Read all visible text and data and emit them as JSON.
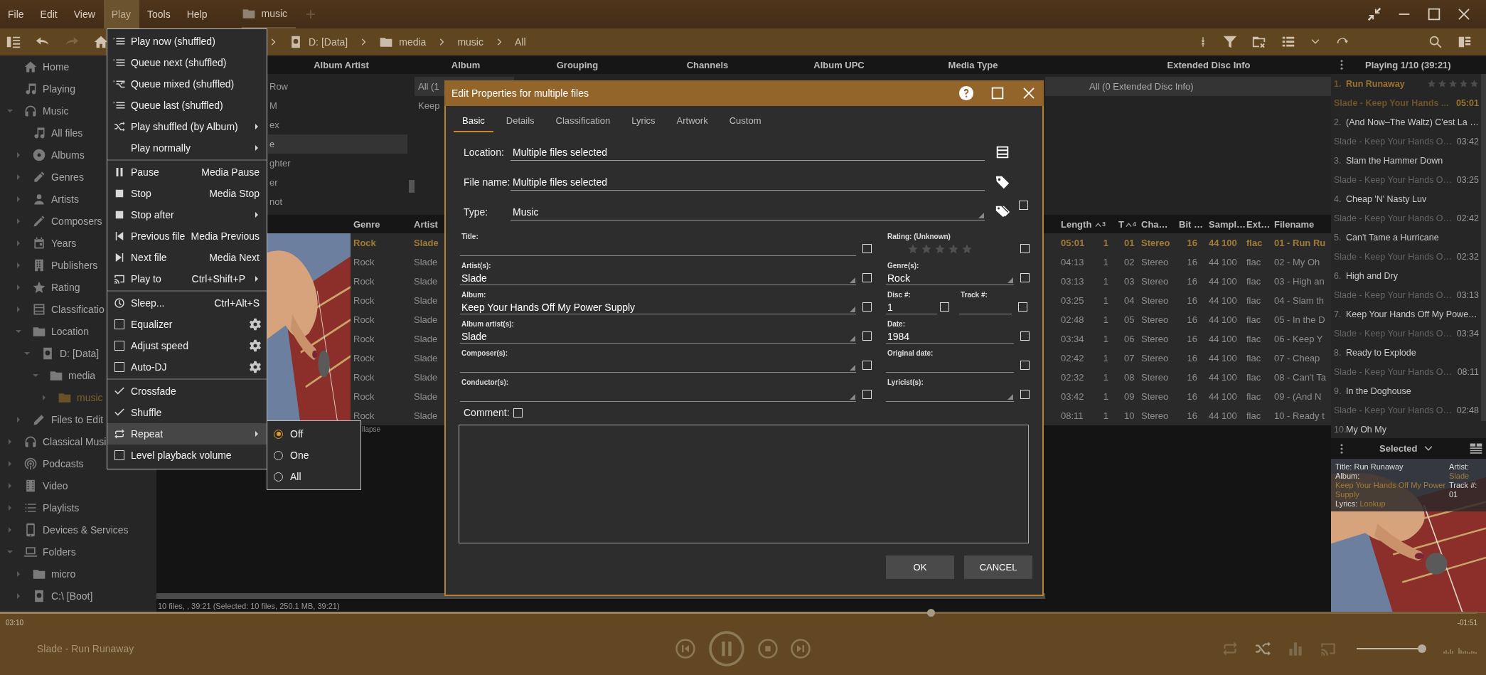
{
  "menu_bar": {
    "menus": [
      {
        "label": "File",
        "selected": false
      },
      {
        "label": "Edit",
        "selected": false
      },
      {
        "label": "View",
        "selected": false
      },
      {
        "label": "Play",
        "selected": true
      },
      {
        "label": "Tools",
        "selected": false
      },
      {
        "label": "Help",
        "selected": false
      }
    ],
    "tab": {
      "label": "music"
    }
  },
  "toolbar": {
    "breadcrumb": [
      {
        "label": "D: [Data]"
      },
      {
        "label": "media"
      },
      {
        "label": "music"
      },
      {
        "label": "All"
      }
    ]
  },
  "sidebar": {
    "items": [
      {
        "label": "Home",
        "selected": false
      },
      {
        "label": "Playing",
        "selected": false
      },
      {
        "label": "Music",
        "selected": false,
        "expanded": true,
        "children": [
          {
            "label": "All files",
            "selected": false
          },
          {
            "label": "Albums",
            "selected": false,
            "expanded": false
          },
          {
            "label": "Genres",
            "selected": false,
            "expanded": false
          },
          {
            "label": "Artists",
            "selected": false,
            "expanded": false
          },
          {
            "label": "Composers",
            "selected": false,
            "expanded": false
          },
          {
            "label": "Years",
            "selected": false,
            "expanded": false
          },
          {
            "label": "Publishers",
            "selected": false,
            "expanded": false
          },
          {
            "label": "Rating",
            "selected": false,
            "expanded": false
          },
          {
            "label": "Classificatio",
            "selected": false,
            "expanded": false
          },
          {
            "label": "Location",
            "selected": false,
            "expanded": true,
            "children": [
              {
                "label": "D: [Data]",
                "selected": false,
                "expanded": true,
                "children": [
                  {
                    "label": "media",
                    "selected": false,
                    "expanded": true,
                    "children": [
                      {
                        "label": "music",
                        "selected": true,
                        "expanded": false
                      }
                    ]
                  }
                ]
              }
            ]
          },
          {
            "label": "Files to Edit",
            "selected": false,
            "expanded": false
          }
        ]
      },
      {
        "label": "Classical Musi",
        "selected": false,
        "expanded": false
      },
      {
        "label": "Podcasts",
        "selected": false,
        "expanded": false
      },
      {
        "label": "Video",
        "selected": false,
        "expanded": false
      },
      {
        "label": "Playlists",
        "selected": false,
        "expanded": false
      },
      {
        "label": "Devices & Services",
        "selected": false,
        "expanded": false
      },
      {
        "label": "Folders",
        "selected": false,
        "expanded": true,
        "children": [
          {
            "label": "micro",
            "selected": false,
            "expanded": false
          },
          {
            "label": "C:\\ [Boot]",
            "selected": false,
            "expanded": false
          }
        ]
      }
    ]
  },
  "categories": [
    {
      "header": "Album Artist",
      "items": [
        {
          "text": "Row",
          "selected": false
        },
        {
          "text": "M",
          "selected": false
        },
        {
          "text": "ex",
          "selected": false
        },
        {
          "text": "e",
          "selected": true
        },
        {
          "text": "ghter",
          "selected": false
        },
        {
          "text": "er",
          "selected": false
        },
        {
          "text": "not",
          "selected": false
        }
      ]
    },
    {
      "header": "Album",
      "items": [
        {
          "text": "All (1",
          "selected": true
        },
        {
          "text": "Keep",
          "selected": false
        }
      ]
    },
    {
      "header": "Grouping"
    },
    {
      "header": "Channels"
    },
    {
      "header": "Album UPC"
    },
    {
      "header": "Media Type"
    },
    {
      "header": "Extended Disc Info",
      "items": [
        {
          "text": "All (0 Extended Disc Info)",
          "selected": true
        }
      ]
    }
  ],
  "file_list": {
    "columns": [
      {
        "label": "Genre"
      },
      {
        "label": "Artist"
      },
      {
        "label": "Length"
      },
      {
        "sort_order": "3"
      },
      {
        "label": "T",
        "sort_order": "4"
      },
      {
        "label": "Cha…"
      },
      {
        "label": "Bit …"
      },
      {
        "label": "Sampl…"
      },
      {
        "label": "Ext…"
      },
      {
        "label": "Filename"
      }
    ],
    "rows": [
      {
        "playing": true,
        "cells": [
          "Rock",
          "Slade",
          "05:01",
          "1",
          "01",
          "Stereo",
          "16",
          "44 100",
          "flac",
          "01 - Run Ru"
        ]
      },
      {
        "playing": false,
        "cells": [
          "Rock",
          "Slade",
          "04:13",
          "1",
          "02",
          "Stereo",
          "16",
          "44 100",
          "flac",
          "02 - My Oh"
        ]
      },
      {
        "playing": false,
        "cells": [
          "Rock",
          "Slade",
          "03:13",
          "1",
          "03",
          "Stereo",
          "16",
          "44 100",
          "flac",
          "03 - High an"
        ]
      },
      {
        "playing": false,
        "cells": [
          "Rock",
          "Slade",
          "03:25",
          "1",
          "04",
          "Stereo",
          "16",
          "44 100",
          "flac",
          "04 - Slam th"
        ]
      },
      {
        "playing": false,
        "cells": [
          "Rock",
          "Slade",
          "02:48",
          "1",
          "05",
          "Stereo",
          "16",
          "44 100",
          "flac",
          "05 - In the D"
        ]
      },
      {
        "playing": false,
        "cells": [
          "Rock",
          "Slade",
          "03:34",
          "1",
          "06",
          "Stereo",
          "16",
          "44 100",
          "flac",
          "06 - Keep Y"
        ]
      },
      {
        "playing": false,
        "cells": [
          "Rock",
          "Slade",
          "02:42",
          "1",
          "07",
          "Stereo",
          "16",
          "44 100",
          "flac",
          "07 - Cheap"
        ]
      },
      {
        "playing": false,
        "cells": [
          "Rock",
          "Slade",
          "02:32",
          "1",
          "08",
          "Stereo",
          "16",
          "44 100",
          "flac",
          "08 - Can't Ta"
        ]
      },
      {
        "playing": false,
        "cells": [
          "Rock",
          "Slade",
          "03:42",
          "1",
          "09",
          "Stereo",
          "16",
          "44 100",
          "flac",
          "09 - (And N"
        ]
      },
      {
        "playing": false,
        "cells": [
          "Rock",
          "Slade",
          "08:11",
          "1",
          "10",
          "Stereo",
          "16",
          "44 100",
          "flac",
          "10 - Ready t"
        ]
      }
    ],
    "group_footer": "llapse",
    "status": "10 files, , 39:21 (Selected: 10 files, 250.1 MB, 39:21)"
  },
  "play_menu": {
    "groups": [
      {
        "items": [
          {
            "kind": "command",
            "label": "Play now (shuffled)",
            "selected": false
          },
          {
            "kind": "command",
            "label": "Queue next (shuffled)",
            "selected": false
          },
          {
            "kind": "command",
            "label": "Queue mixed (shuffled)",
            "selected": false
          },
          {
            "kind": "command",
            "label": "Queue last (shuffled)",
            "selected": false
          },
          {
            "kind": "command",
            "label": "Play shuffled (by Album)",
            "submenu": true,
            "selected": false
          },
          {
            "kind": "command",
            "label": "Play normally",
            "submenu": true,
            "selected": false
          }
        ]
      },
      {
        "items": [
          {
            "kind": "command",
            "label": "Pause",
            "shortcut": "Media Pause",
            "selected": false
          },
          {
            "kind": "command",
            "label": "Stop",
            "shortcut": "Media Stop",
            "selected": false
          },
          {
            "kind": "command",
            "label": "Stop after",
            "submenu": true,
            "selected": false
          },
          {
            "kind": "command",
            "label": "Previous file",
            "shortcut": "Media Previous",
            "selected": false
          },
          {
            "kind": "command",
            "label": "Next file",
            "shortcut": "Media Next",
            "selected": false
          },
          {
            "kind": "command",
            "label": "Play to",
            "shortcut": "Ctrl+Shift+P",
            "submenu": true,
            "selected": false
          }
        ]
      },
      {
        "items": [
          {
            "kind": "command",
            "label": "Sleep...",
            "shortcut": "Ctrl+Alt+S",
            "selected": false
          },
          {
            "kind": "check",
            "label": "Equalizer",
            "checked": false,
            "settings": true,
            "selected": false
          },
          {
            "kind": "check",
            "label": "Adjust speed",
            "checked": false,
            "settings": true,
            "selected": false
          },
          {
            "kind": "check",
            "label": "Auto-DJ",
            "checked": false,
            "settings": true,
            "selected": false
          }
        ]
      },
      {
        "items": [
          {
            "kind": "check",
            "label": "Crossfade",
            "checked": true,
            "selected": false
          },
          {
            "kind": "check",
            "label": "Shuffle",
            "checked": true,
            "selected": false
          },
          {
            "kind": "command",
            "label": "Repeat",
            "submenu": true,
            "selected": true
          },
          {
            "kind": "check",
            "label": "Level playback volume",
            "checked": false,
            "selected": false
          }
        ]
      }
    ]
  },
  "repeat_submenu": {
    "options": [
      {
        "label": "Off",
        "selected": true
      },
      {
        "label": "One",
        "selected": false
      },
      {
        "label": "All",
        "selected": false
      }
    ]
  },
  "dialog": {
    "title": "Edit Properties for multiple files",
    "tabs": [
      {
        "label": "Basic",
        "selected": true
      },
      {
        "label": "Details",
        "selected": false
      },
      {
        "label": "Classification",
        "selected": false
      },
      {
        "label": "Lyrics",
        "selected": false
      },
      {
        "label": "Artwork",
        "selected": false
      },
      {
        "label": "Custom",
        "selected": false
      }
    ],
    "top_fields": [
      {
        "kind": "text",
        "label": "Location:",
        "value": "Multiple files selected"
      },
      {
        "kind": "text",
        "label": "File name:",
        "value": "Multiple files selected"
      },
      {
        "kind": "choice",
        "label": "Type:",
        "value": "Music",
        "checked": false
      }
    ],
    "left_fields": [
      {
        "label": "Title:",
        "dropdown": false,
        "checked": false
      },
      {
        "label": "Artist(s):",
        "value": "Slade",
        "dropdown": true,
        "checked": false
      },
      {
        "label": "Album:",
        "value": "Keep Your Hands Off My Power Supply",
        "dropdown": true,
        "checked": false
      },
      {
        "label": "Album artist(s):",
        "value": "Slade",
        "dropdown": true,
        "checked": false
      },
      {
        "label": "Composer(s):",
        "dropdown": true,
        "checked": false
      },
      {
        "label": "Conductor(s):",
        "dropdown": true,
        "checked": false
      }
    ],
    "right_fields": [
      {
        "kind": "rating",
        "label": "Rating:",
        "value": "(Unknown)",
        "stars": 0,
        "checked": false
      },
      {
        "kind": "field",
        "label": "Genre(s):",
        "value": "Rock",
        "dropdown": true,
        "checked": false
      },
      {
        "kind": "pair",
        "fields": [
          {
            "label": "Disc #:",
            "value": "1",
            "checked": false
          },
          {
            "label": "Track #:",
            "checked": false
          }
        ]
      },
      {
        "kind": "field",
        "label": "Date:",
        "value": "1984",
        "dropdown": false,
        "checked": false
      },
      {
        "kind": "field",
        "label": "Original date:",
        "dropdown": false,
        "checked": false
      },
      {
        "kind": "field",
        "label": "Lyricist(s):",
        "dropdown": true,
        "checked": false
      }
    ],
    "comment": {
      "label": "Comment:",
      "checked": false
    },
    "buttons": [
      "OK",
      "CANCEL"
    ]
  },
  "playing_list": {
    "title": "Playing 1/10 (39:21)",
    "tracks": [
      {
        "number": "1.",
        "title": "Run Runaway",
        "stars": 0,
        "subtitle": "Slade - Keep Your Hands ...",
        "time": "05:01",
        "playing": true
      },
      {
        "number": "2.",
        "title": "(And Now–The Waltz) C'est La …",
        "subtitle": "Slade - Keep Your Hands O…",
        "time": "03:42",
        "playing": false
      },
      {
        "number": "3.",
        "title": "Slam the Hammer Down",
        "subtitle": "Slade - Keep Your Hands O…",
        "time": "03:25",
        "playing": false
      },
      {
        "number": "4.",
        "title": "Cheap 'N' Nasty Luv",
        "subtitle": "Slade - Keep Your Hands O…",
        "time": "02:42",
        "playing": false
      },
      {
        "number": "5.",
        "title": "Can't Tame a Hurricane",
        "subtitle": "Slade - Keep Your Hands O…",
        "time": "02:32",
        "playing": false
      },
      {
        "number": "6.",
        "title": "High and Dry",
        "subtitle": "Slade - Keep Your Hands O…",
        "time": "03:13",
        "playing": false
      },
      {
        "number": "7.",
        "title": "Keep Your Hands Off My Powe…",
        "subtitle": "Slade - Keep Your Hands O…",
        "time": "03:34",
        "playing": false
      },
      {
        "number": "8.",
        "title": "Ready to Explode",
        "subtitle": "Slade - Keep Your Hands O…",
        "time": "08:11",
        "playing": false
      },
      {
        "number": "9.",
        "title": "In the Doghouse",
        "subtitle": "Slade - Keep Your Hands O…",
        "time": "02:48",
        "playing": false
      },
      {
        "number": "10.",
        "title": "My Oh My",
        "playing": false
      }
    ]
  },
  "selected_panel": {
    "title": "Selected",
    "info": {
      "title_label": "Title:",
      "title": "Run Runaway",
      "album_label": "Album:",
      "album": "Keep Your Hands Off My Power Supply",
      "lyrics_label": "Lyrics:",
      "lyrics": "Lookup",
      "artist_label": "Artist:",
      "artist": "Slade",
      "track_label": "Track #:",
      "track": "01"
    }
  },
  "player": {
    "elapsed": "03:10",
    "remaining": "-01:51",
    "now_playing": "Slade - Run Runaway",
    "progress": {
      "level": 0.63
    },
    "playing": true,
    "repeat": false,
    "shuffle": true,
    "volume": {
      "level": 0.97
    }
  }
}
